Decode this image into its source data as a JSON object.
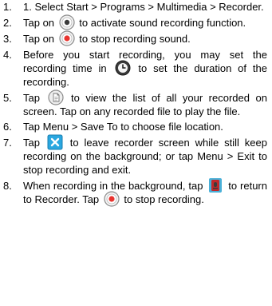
{
  "steps": [
    {
      "num": "1.",
      "parts": [
        "1. Select Start > Programs > Multimedia > Recorder."
      ]
    },
    {
      "num": "2.",
      "parts": [
        "Tap on",
        "to activate sound recording function."
      ],
      "icons": [
        "record-icon"
      ]
    },
    {
      "num": "3.",
      "parts": [
        "Tap on",
        "to stop recording sound."
      ],
      "icons": [
        "stop-record-icon"
      ]
    },
    {
      "num": "4.",
      "parts": [
        "Before you start recording, you may set the recording time in",
        "to set the duration of the recording."
      ],
      "icons": [
        "timer-icon"
      ]
    },
    {
      "num": "5.",
      "parts": [
        "Tap",
        "to view the list of all your recorded on screen. Tap on any recorded file to play the file."
      ],
      "icons": [
        "file-list-icon"
      ]
    },
    {
      "num": "6.",
      "parts": [
        "Tap Menu > Save To to choose file location."
      ]
    },
    {
      "num": "7.",
      "parts": [
        "Tap",
        "to leave recorder screen while still keep recording on the background; or tap Menu > Exit to stop recording and exit."
      ],
      "icons": [
        "close-icon"
      ]
    },
    {
      "num": "8.",
      "parts": [
        "When recording in the background, tap",
        "to return to Recorder. Tap",
        "to stop recording."
      ],
      "icons": [
        "recorder-app-icon",
        "stop-record-icon"
      ]
    }
  ],
  "colors": {
    "record_red": "#e8332e",
    "close_blue": "#2aa7e0",
    "text": "#000000"
  }
}
